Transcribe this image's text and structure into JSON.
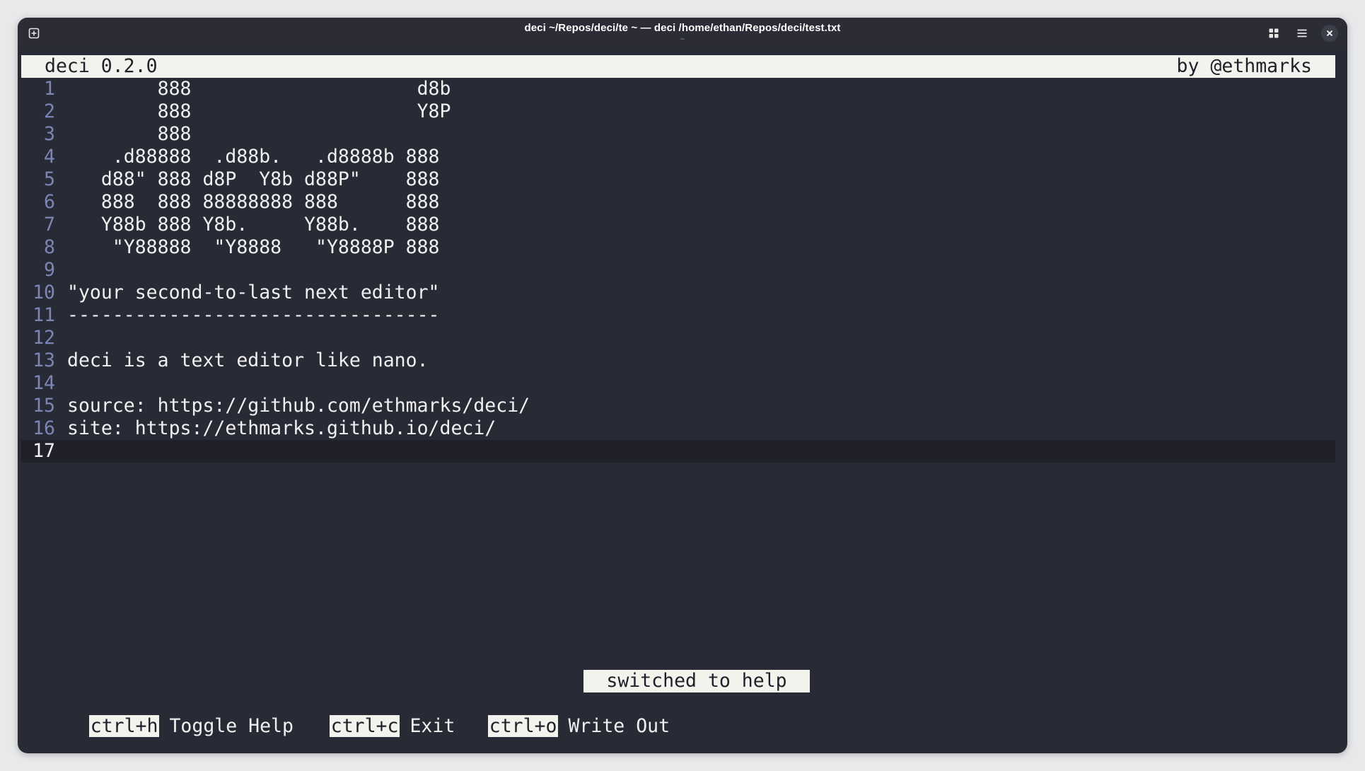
{
  "window": {
    "title": "deci ~/Repos/deci/te ~ — deci /home/ethan/Repos/deci/test.txt",
    "subtitle": "~",
    "buttons": {
      "new_tab": "new-tab-icon",
      "layout": "grid-icon",
      "menu": "hamburger-menu-icon",
      "close": "close-icon"
    }
  },
  "editor": {
    "name": "deci 0.2.0",
    "author": "by @ethmarks",
    "current_line": 17,
    "lines": [
      {
        "n": "1",
        "text": "        888                    d8b"
      },
      {
        "n": "2",
        "text": "        888                    Y8P"
      },
      {
        "n": "3",
        "text": "        888"
      },
      {
        "n": "4",
        "text": "    .d88888  .d88b.   .d8888b 888"
      },
      {
        "n": "5",
        "text": "   d88\" 888 d8P  Y8b d88P\"    888"
      },
      {
        "n": "6",
        "text": "   888  888 88888888 888      888"
      },
      {
        "n": "7",
        "text": "   Y88b 888 Y8b.     Y88b.    888"
      },
      {
        "n": "8",
        "text": "    \"Y88888  \"Y8888   \"Y8888P 888"
      },
      {
        "n": "9",
        "text": ""
      },
      {
        "n": "10",
        "text": "\"your second-to-last next editor\""
      },
      {
        "n": "11",
        "text": "---------------------------------"
      },
      {
        "n": "12",
        "text": ""
      },
      {
        "n": "13",
        "text": "deci is a text editor like nano."
      },
      {
        "n": "14",
        "text": ""
      },
      {
        "n": "15",
        "text": "source: https://github.com/ethmarks/deci/"
      },
      {
        "n": "16",
        "text": "site: https://ethmarks.github.io/deci/"
      },
      {
        "n": "17",
        "text": ""
      }
    ],
    "status_message": "switched to help",
    "shortcuts": [
      {
        "key": "ctrl+h",
        "label": "Toggle Help"
      },
      {
        "key": "ctrl+c",
        "label": "Exit"
      },
      {
        "key": "ctrl+o",
        "label": "Write Out"
      }
    ]
  },
  "colors": {
    "background": "#282a36",
    "line_number": "#7c86b4",
    "header_bg": "#f3f3ee",
    "current_line_bg": "#1f2029"
  }
}
